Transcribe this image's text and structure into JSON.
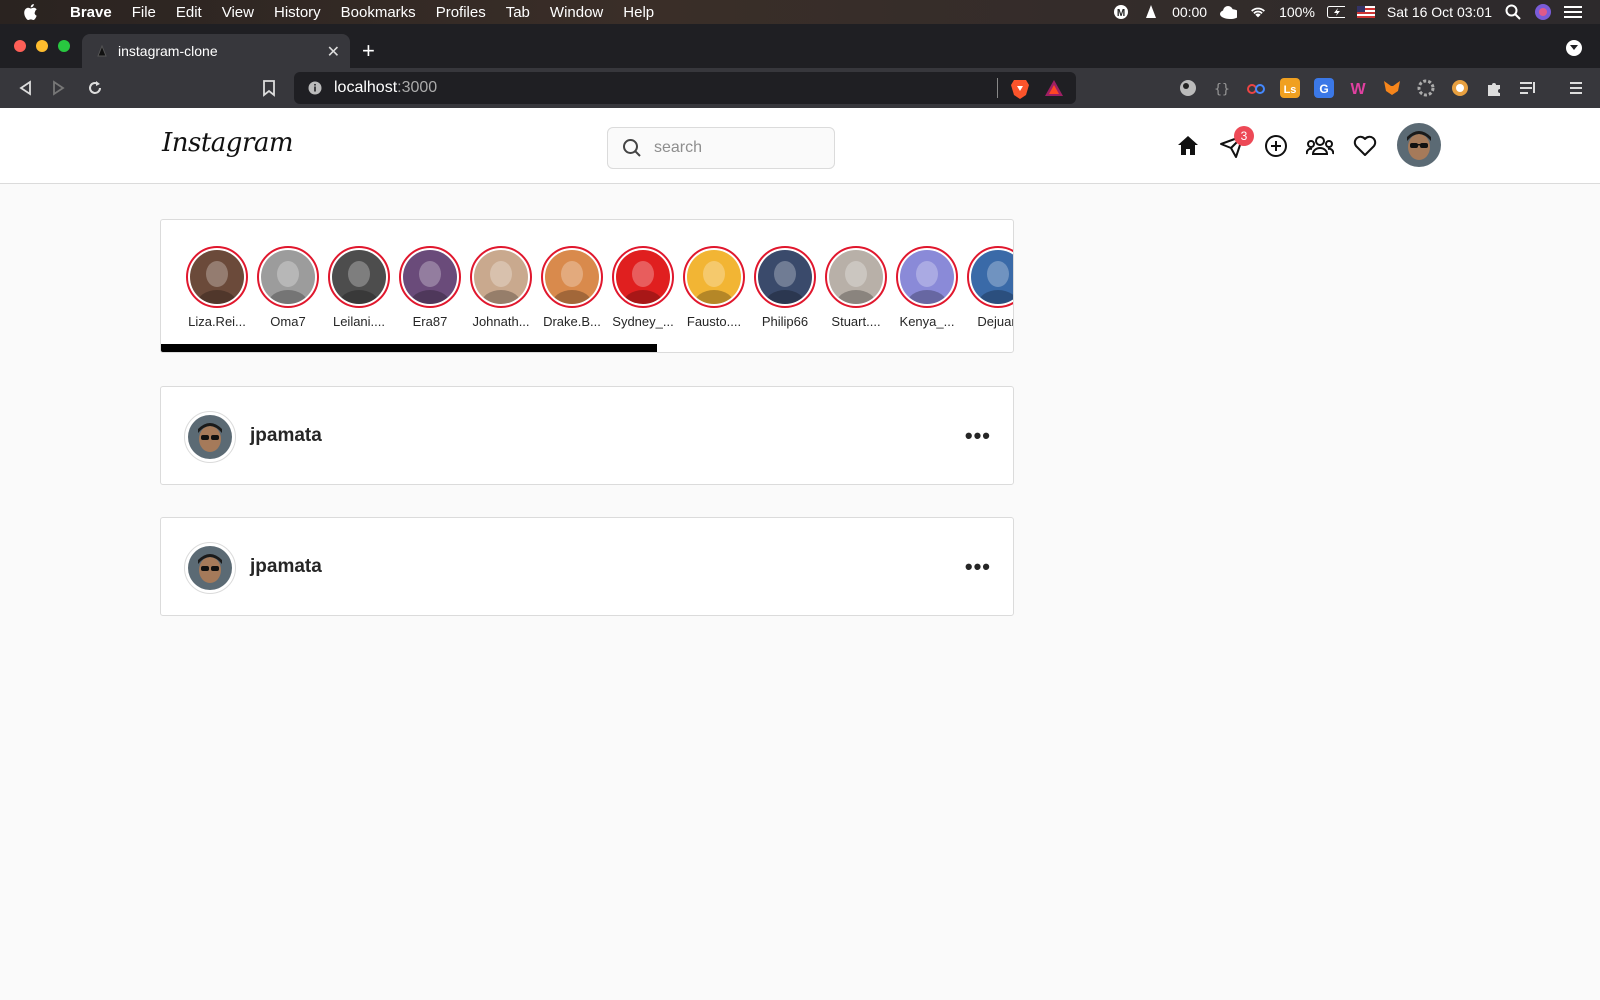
{
  "menubar": {
    "app": "Brave",
    "items": [
      "File",
      "Edit",
      "View",
      "History",
      "Bookmarks",
      "Profiles",
      "Tab",
      "Window",
      "Help"
    ],
    "clock_timer": "00:00",
    "battery": "100%",
    "datetime": "Sat 16 Oct  03:01"
  },
  "browser": {
    "tab_title": "instagram-clone",
    "url_host": "localhost",
    "url_port": ":3000"
  },
  "header": {
    "logo": "Instagram",
    "search_placeholder": "search",
    "messages_badge": "3"
  },
  "stories": [
    {
      "name": "Liza.Rei...",
      "color": "#6b4a3a"
    },
    {
      "name": "Oma7",
      "color": "#9c9c9c"
    },
    {
      "name": "Leilani....",
      "color": "#4d4d4d"
    },
    {
      "name": "Era87",
      "color": "#6a4b7a"
    },
    {
      "name": "Johnath...",
      "color": "#c9a98e"
    },
    {
      "name": "Drake.B...",
      "color": "#d98a4c"
    },
    {
      "name": "Sydney_...",
      "color": "#e01f1f"
    },
    {
      "name": "Fausto....",
      "color": "#f2b534"
    },
    {
      "name": "Philip66",
      "color": "#3a4a6b"
    },
    {
      "name": "Stuart....",
      "color": "#b8b0a8"
    },
    {
      "name": "Kenya_...",
      "color": "#8a8ad8"
    },
    {
      "name": "Dejuan",
      "color": "#3a6aa8"
    }
  ],
  "posts": [
    {
      "username": "jpamata",
      "more": "•••"
    },
    {
      "username": "jpamata",
      "more": "•••"
    }
  ],
  "colors": {
    "story_ring": "#e0172d",
    "badge": "#ed4956"
  }
}
